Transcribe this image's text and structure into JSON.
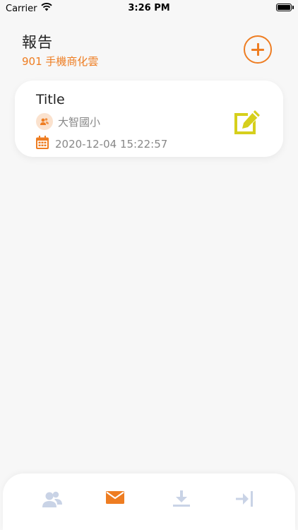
{
  "status_bar": {
    "carrier": "Carrier",
    "time": "3:26 PM"
  },
  "header": {
    "title": "報告",
    "subtitle": "901 手機商化雲"
  },
  "report_card": {
    "title": "Title",
    "organization": "大智國小",
    "datetime": "2020-12-04 15:22:57"
  },
  "colors": {
    "accent": "#ee7d22",
    "edit": "#d6cf1c",
    "tab_inactive": "#c9d3e6"
  },
  "tabs": [
    {
      "icon": "users-icon",
      "active": false
    },
    {
      "icon": "mail-icon",
      "active": true
    },
    {
      "icon": "download-icon",
      "active": false
    },
    {
      "icon": "logout-icon",
      "active": false
    }
  ]
}
